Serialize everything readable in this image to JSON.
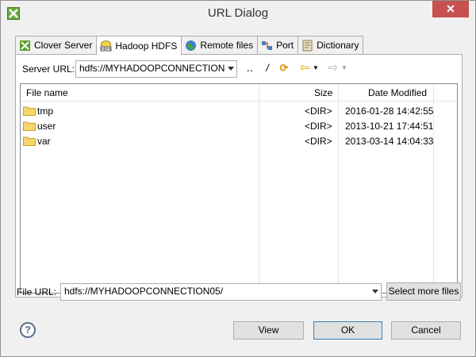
{
  "window": {
    "title": "URL Dialog",
    "close_glyph": "✕"
  },
  "tabs": [
    {
      "label": "Clover Server",
      "icon": "clover-server-icon",
      "active": false
    },
    {
      "label": "Hadoop HDFS",
      "icon": "hdfs-icon",
      "active": true
    },
    {
      "label": "Remote files",
      "icon": "globe-icon",
      "active": false
    },
    {
      "label": "Port",
      "icon": "port-icon",
      "active": false
    },
    {
      "label": "Dictionary",
      "icon": "dictionary-icon",
      "active": false
    }
  ],
  "server": {
    "label": "Server URL:",
    "value": "hdfs://MYHADOOPCONNECTION",
    "toolbar": {
      "parent_dir": "‥",
      "root": "/",
      "refresh": "⟳",
      "back": "⇦",
      "forward": "⇨"
    }
  },
  "table": {
    "headers": {
      "name": "File name",
      "size": "Size",
      "date": "Date Modified"
    },
    "rows": [
      {
        "name": "tmp",
        "size": "<DIR>",
        "date": "2016-01-28 14:42:55"
      },
      {
        "name": "user",
        "size": "<DIR>",
        "date": "2013-10-21 17:44:51"
      },
      {
        "name": "var",
        "size": "<DIR>",
        "date": "2013-03-14 14:04:33"
      }
    ]
  },
  "file_url": {
    "label": "File URL:",
    "value": "hdfs://MYHADOOPCONNECTION05/",
    "select_more": "Select more files"
  },
  "buttons": {
    "view": "View",
    "ok": "OK",
    "cancel": "Cancel",
    "help": "?"
  },
  "colors": {
    "folder": "#f5d76e",
    "folder_edge": "#c9a227",
    "close": "#c75050"
  }
}
